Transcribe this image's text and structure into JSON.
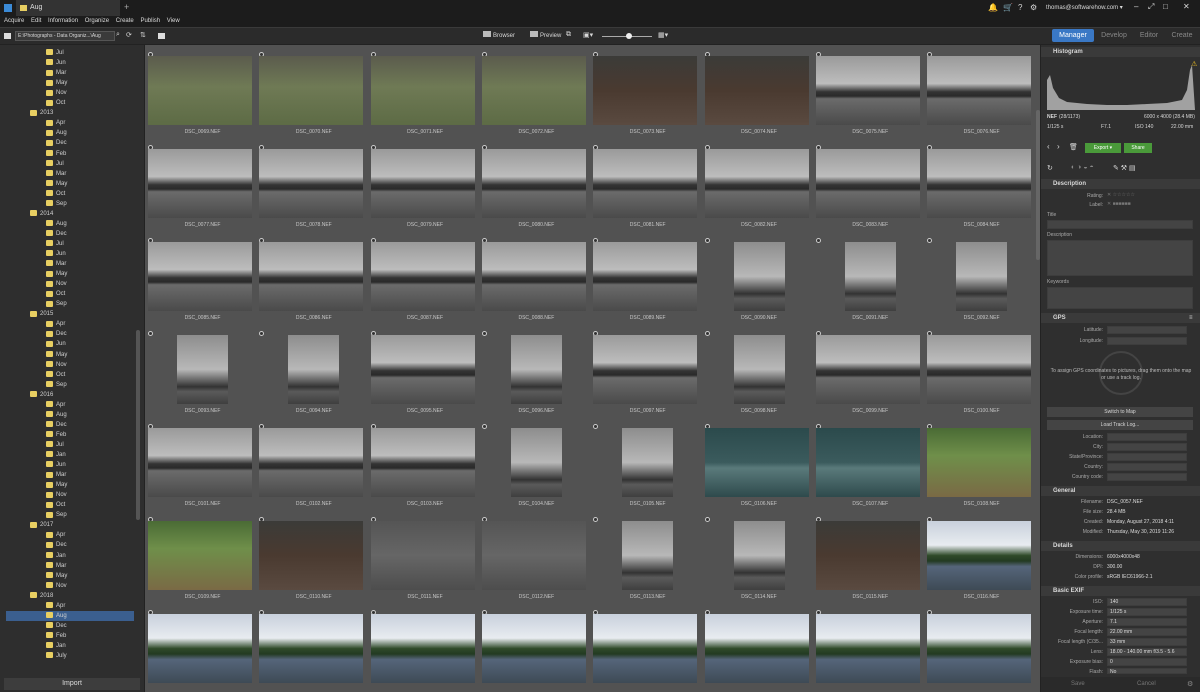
{
  "tab": {
    "label": "Aug",
    "add": "+"
  },
  "window": {
    "email": "thomas@softwarehow.com ▾",
    "minimize": "–",
    "restore": "⤢",
    "maximize": "□",
    "close": "✕"
  },
  "menu": [
    "Acquire",
    "Edit",
    "Information",
    "Organize",
    "Create",
    "Publish",
    "View"
  ],
  "path": "E:\\Photographs - Data Organiz...\\Aug",
  "toolbar": {
    "browser": "Browser",
    "preview": "Preview"
  },
  "modes": [
    "Manager",
    "Develop",
    "Editor",
    "Create"
  ],
  "tree": [
    {
      "t": "Jul",
      "lvl": 2
    },
    {
      "t": "Jun",
      "lvl": 2
    },
    {
      "t": "Mar",
      "lvl": 2
    },
    {
      "t": "May",
      "lvl": 2
    },
    {
      "t": "Nov",
      "lvl": 2
    },
    {
      "t": "Oct",
      "lvl": 2
    },
    {
      "t": "2013",
      "lvl": 1
    },
    {
      "t": "Apr",
      "lvl": 2
    },
    {
      "t": "Aug",
      "lvl": 2
    },
    {
      "t": "Dec",
      "lvl": 2
    },
    {
      "t": "Feb",
      "lvl": 2
    },
    {
      "t": "Jul",
      "lvl": 2
    },
    {
      "t": "Mar",
      "lvl": 2
    },
    {
      "t": "May",
      "lvl": 2
    },
    {
      "t": "Oct",
      "lvl": 2
    },
    {
      "t": "Sep",
      "lvl": 2
    },
    {
      "t": "2014",
      "lvl": 1
    },
    {
      "t": "Aug",
      "lvl": 2
    },
    {
      "t": "Dec",
      "lvl": 2
    },
    {
      "t": "Jul",
      "lvl": 2
    },
    {
      "t": "Jun",
      "lvl": 2
    },
    {
      "t": "Mar",
      "lvl": 2
    },
    {
      "t": "May",
      "lvl": 2
    },
    {
      "t": "Nov",
      "lvl": 2
    },
    {
      "t": "Oct",
      "lvl": 2
    },
    {
      "t": "Sep",
      "lvl": 2
    },
    {
      "t": "2015",
      "lvl": 1
    },
    {
      "t": "Apr",
      "lvl": 2
    },
    {
      "t": "Dec",
      "lvl": 2
    },
    {
      "t": "Jun",
      "lvl": 2
    },
    {
      "t": "May",
      "lvl": 2
    },
    {
      "t": "Nov",
      "lvl": 2
    },
    {
      "t": "Oct",
      "lvl": 2
    },
    {
      "t": "Sep",
      "lvl": 2
    },
    {
      "t": "2016",
      "lvl": 1
    },
    {
      "t": "Apr",
      "lvl": 2
    },
    {
      "t": "Aug",
      "lvl": 2
    },
    {
      "t": "Dec",
      "lvl": 2
    },
    {
      "t": "Feb",
      "lvl": 2
    },
    {
      "t": "Jul",
      "lvl": 2
    },
    {
      "t": "Jan",
      "lvl": 2
    },
    {
      "t": "Jun",
      "lvl": 2
    },
    {
      "t": "Mar",
      "lvl": 2
    },
    {
      "t": "May",
      "lvl": 2
    },
    {
      "t": "Nov",
      "lvl": 2
    },
    {
      "t": "Oct",
      "lvl": 2
    },
    {
      "t": "Sep",
      "lvl": 2
    },
    {
      "t": "2017",
      "lvl": 1
    },
    {
      "t": "Apr",
      "lvl": 2
    },
    {
      "t": "Dec",
      "lvl": 2
    },
    {
      "t": "Jan",
      "lvl": 2
    },
    {
      "t": "Mar",
      "lvl": 2
    },
    {
      "t": "May",
      "lvl": 2
    },
    {
      "t": "Nov",
      "lvl": 2
    },
    {
      "t": "2018",
      "lvl": 1
    },
    {
      "t": "Apr",
      "lvl": 2
    },
    {
      "t": "Aug",
      "lvl": 2,
      "selected": true
    },
    {
      "t": "Dec",
      "lvl": 2
    },
    {
      "t": "Feb",
      "lvl": 2
    },
    {
      "t": "Jan",
      "lvl": 2
    },
    {
      "t": "July",
      "lvl": 2
    }
  ],
  "import_label": "Import",
  "photos": [
    "DSC_0069.NEF",
    "DSC_0070.NEF",
    "DSC_0071.NEF",
    "DSC_0072.NEF",
    "DSC_0073.NEF",
    "DSC_0074.NEF",
    "DSC_0075.NEF",
    "DSC_0076.NEF",
    "DSC_0077.NEF",
    "DSC_0078.NEF",
    "DSC_0079.NEF",
    "DSC_0080.NEF",
    "DSC_0081.NEF",
    "DSC_0082.NEF",
    "DSC_0083.NEF",
    "DSC_0084.NEF",
    "DSC_0085.NEF",
    "DSC_0086.NEF",
    "DSC_0087.NEF",
    "DSC_0088.NEF",
    "DSC_0089.NEF",
    "DSC_0090.NEF",
    "DSC_0091.NEF",
    "DSC_0092.NEF",
    "DSC_0093.NEF",
    "DSC_0094.NEF",
    "DSC_0095.NEF",
    "DSC_0096.NEF",
    "DSC_0097.NEF",
    "DSC_0098.NEF",
    "DSC_0099.NEF",
    "DSC_0100.NEF",
    "DSC_0101.NEF",
    "DSC_0102.NEF",
    "DSC_0103.NEF",
    "DSC_0104.NEF",
    "DSC_0105.NEF",
    "DSC_0106.NEF",
    "DSC_0107.NEF",
    "DSC_0108.NEF",
    "DSC_0109.NEF",
    "DSC_0110.NEF",
    "DSC_0111.NEF",
    "DSC_0112.NEF",
    "DSC_0113.NEF",
    "DSC_0114.NEF",
    "DSC_0115.NEF",
    "DSC_0116.NEF",
    "",
    "",
    "",
    "",
    "",
    "",
    "",
    ""
  ],
  "thumbs": [
    "g",
    "g",
    "g",
    "g",
    "b",
    "b",
    "l",
    "l",
    "l",
    "l",
    "l",
    "l",
    "l",
    "l",
    "l",
    "l",
    "l",
    "l",
    "l",
    "l",
    "l",
    "p",
    "p",
    "p",
    "p",
    "p",
    "l",
    "p",
    "l",
    "p",
    "l",
    "l",
    "l",
    "l",
    "l",
    "p",
    "p",
    "t",
    "t",
    "f",
    "f",
    "b",
    "r",
    "r",
    "p",
    "p",
    "b",
    "w",
    "w",
    "w",
    "w",
    "w",
    "w",
    "w",
    "w",
    "w"
  ],
  "histogram": {
    "title": "Histogram",
    "format": "NEF",
    "index": "(28/1173)",
    "dims": "6000 x 4000 (28.4 MB)",
    "shutter": "1/125 s",
    "aperture": "F7.1",
    "iso": "ISO 140",
    "focal": "22.00 mm"
  },
  "actions": {
    "export": "Export ▾",
    "share": "Share"
  },
  "description": {
    "title": "Description",
    "rating": "Rating:",
    "label": "Label:",
    "title_field": "Title",
    "desc_field": "Description",
    "keywords": "Keywords"
  },
  "gps": {
    "title": "GPS",
    "latitude": "Latitude:",
    "longitude": "Longitude:",
    "hint": "To assign GPS coordinates to pictures, drag them onto the map or use a track log.",
    "switch": "Switch to Map",
    "load": "Load Track Log...",
    "location": "Location:",
    "city": "City:",
    "state": "State/Province:",
    "country": "Country:",
    "country_code": "Country code:"
  },
  "general": {
    "title": "General",
    "filename_l": "Filename:",
    "filename": "DSC_0057.NEF",
    "filesize_l": "File size:",
    "filesize": "28.4 MB",
    "created_l": "Created:",
    "created": "Monday, August 27, 2018 4:11",
    "modified_l": "Modified:",
    "modified": "Thursday, May 30, 2019 11:26"
  },
  "details": {
    "title": "Details",
    "dims_l": "Dimensions:",
    "dims": "6000x4000x48",
    "dpi_l": "DPI:",
    "dpi": "300.00",
    "profile_l": "Color profile:",
    "profile": "sRGB IEC61966-2.1"
  },
  "exif": {
    "title": "Basic EXIF",
    "iso_l": "ISO:",
    "iso": "140",
    "exp_l": "Exposure time:",
    "exp": "1/125 s",
    "ap_l": "Aperture:",
    "ap": "7.1",
    "fl_l": "Focal length:",
    "fl": "22.00 mm",
    "fl35_l": "Focal length (C/35...",
    "fl35": "33 mm",
    "lens_l": "Lens:",
    "lens": "18.00 - 140.00 mm f/3.5 - 5.6",
    "bias_l": "Exposure bias:",
    "bias": "0",
    "flash_l": "Flash:",
    "flash": "No"
  },
  "footer": {
    "save": "Save",
    "cancel": "Cancel"
  }
}
